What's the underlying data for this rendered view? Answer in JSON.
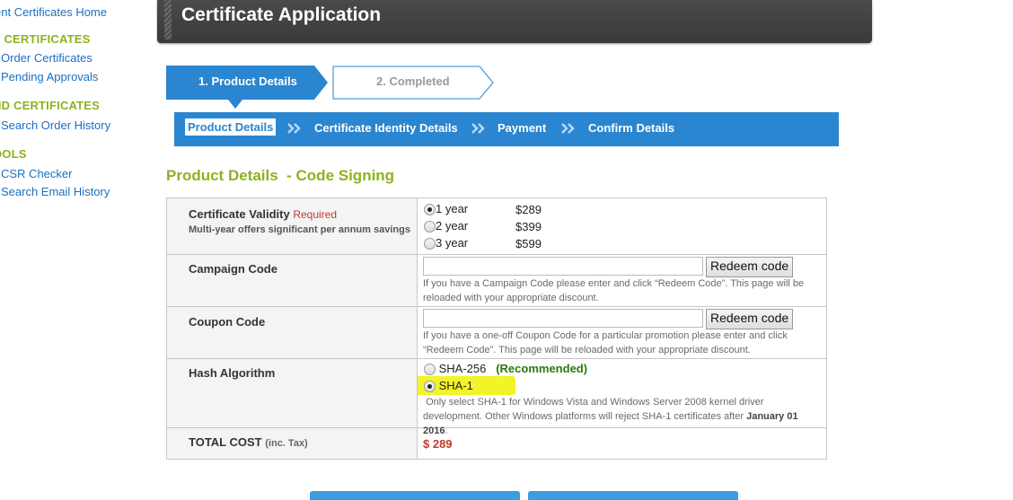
{
  "sidebar": {
    "home_link": "ent Certificates Home",
    "sections": [
      {
        "heading": "Y CERTIFICATES",
        "items": [
          "Order Certificates",
          "Pending Approvals"
        ]
      },
      {
        "heading": "ND CERTIFICATES",
        "items": [
          "Search Order History"
        ]
      },
      {
        "heading": "OOLS",
        "items": [
          "CSR Checker",
          "Search Email History"
        ]
      }
    ]
  },
  "header": {
    "title": "Certificate Application"
  },
  "steps": {
    "step1": "1. Product Details",
    "step2": "2. Completed"
  },
  "subnav": {
    "items": [
      "Product Details",
      "Certificate Identity Details",
      "Payment",
      "Confirm Details"
    ]
  },
  "section_title": "Product Details  - Code Signing",
  "form": {
    "validity": {
      "label": "Certificate Validity",
      "required": "Required",
      "sublabel": "Multi-year offers significant per annum savings",
      "options": [
        {
          "label": "1 year",
          "price": "$289",
          "selected": true
        },
        {
          "label": "2 year",
          "price": "$399",
          "selected": false
        },
        {
          "label": "3 year",
          "price": "$599",
          "selected": false
        }
      ]
    },
    "campaign": {
      "label": "Campaign Code",
      "value": "",
      "button": "Redeem code",
      "help": "If you have a Campaign Code please enter and click “Redeem Code”. This page will be reloaded with your appropriate discount."
    },
    "coupon": {
      "label": "Coupon Code",
      "value": "",
      "button": "Redeem code",
      "help": "If you have a one-off Coupon Code for a particular promotion please enter and click “Redeem Code”. This page will be reloaded with your appropriate discount."
    },
    "hash": {
      "label": "Hash Algorithm",
      "options": [
        {
          "label": "SHA-256",
          "note": "(Recommended)",
          "selected": false
        },
        {
          "label": "SHA-1",
          "selected": true
        }
      ],
      "help_prefix": "Only select SHA-1 for Windows Vista and Windows Server 2008 kernel driver development. Other Windows platforms will reject SHA-1 certificates after ",
      "help_date": "January 01 2016",
      "help_suffix": "."
    },
    "total": {
      "label": "TOTAL COST",
      "suffix": "(inc. Tax)",
      "value": "$ 289"
    }
  },
  "colors": {
    "accent_blue": "#2a86d0",
    "section_green": "#8cb21f",
    "total_red": "#c0392b",
    "highlight_yellow": "#f3f32a"
  }
}
